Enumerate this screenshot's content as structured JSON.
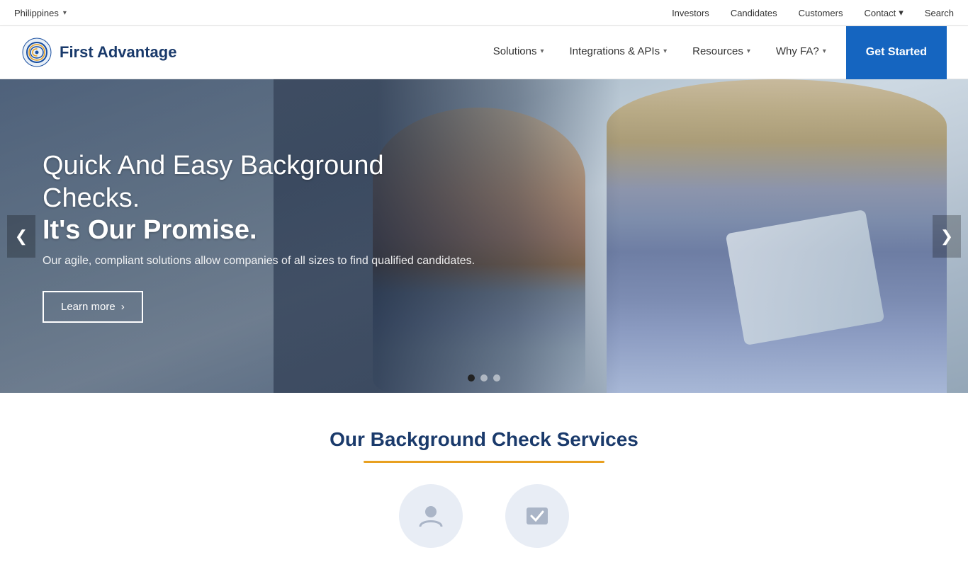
{
  "topbar": {
    "region": "Philippines",
    "chevron": "▾",
    "links": [
      {
        "label": "Investors",
        "name": "investors-link"
      },
      {
        "label": "Candidates",
        "name": "candidates-link"
      },
      {
        "label": "Customers",
        "name": "customers-link"
      },
      {
        "label": "Contact",
        "name": "contact-link",
        "has_chevron": true
      },
      {
        "label": "Search",
        "name": "search-link"
      }
    ]
  },
  "navbar": {
    "logo_text": "First Advantage",
    "items": [
      {
        "label": "Solutions",
        "has_chevron": true,
        "name": "nav-solutions"
      },
      {
        "label": "Integrations & APIs",
        "has_chevron": true,
        "name": "nav-integrations"
      },
      {
        "label": "Resources",
        "has_chevron": true,
        "name": "nav-resources"
      },
      {
        "label": "Why FA?",
        "has_chevron": true,
        "name": "nav-whyfa"
      }
    ],
    "cta": "Get Started"
  },
  "hero": {
    "title_line1": "Quick And Easy Background Checks.",
    "title_line2": "It's Our Promise.",
    "subtitle": "Our agile, compliant solutions allow companies of all sizes to find qualified candidates.",
    "cta_label": "Learn more",
    "cta_chevron": "›",
    "arrow_left": "❮",
    "arrow_right": "❯"
  },
  "services_section": {
    "title": "Our Background Check Services",
    "underline_color": "#e8a020"
  }
}
